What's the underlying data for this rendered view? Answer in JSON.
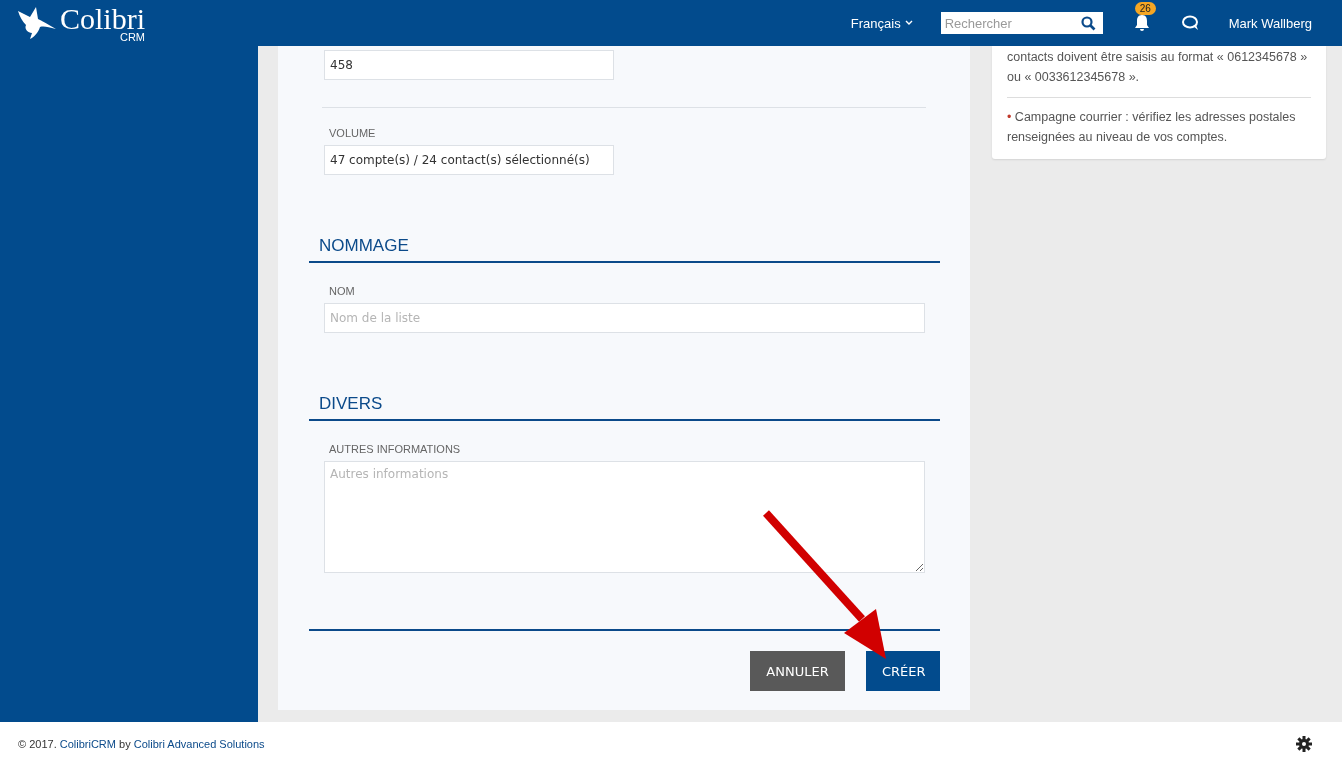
{
  "header": {
    "logo_title": "Colibri",
    "logo_subtitle": "CRM",
    "language": "Français",
    "search": {
      "placeholder": "Rechercher"
    },
    "notification_count": "26",
    "user": "Mark Wallberg"
  },
  "form": {
    "top_field": {
      "value": "458"
    },
    "volume": {
      "label": "VOLUME",
      "value": "47 compte(s) / 24 contact(s) sélectionné(s)"
    },
    "sections": [
      {
        "title": "NOMMAGE",
        "fields": [
          {
            "kind": "input",
            "label": "NOM",
            "placeholder": "Nom de la liste"
          }
        ]
      },
      {
        "title": "DIVERS",
        "fields": [
          {
            "kind": "textarea",
            "label": "AUTRES INFORMATIONS",
            "placeholder": "Autres informations"
          }
        ]
      }
    ],
    "buttons": [
      {
        "kind": "secondary",
        "label": "ANNULER"
      },
      {
        "kind": "primary",
        "label": "CRÉER"
      }
    ]
  },
  "side_panel": {
    "notes": [
      {
        "text": "contacts doivent être saisis au format « 0612345678 » ou « 0033612345678 »."
      },
      {
        "bullet": "•",
        "text": "Campagne courrier : vérifiez les adresses postales renseignées au niveau de vos comptes."
      }
    ]
  },
  "footer": {
    "prefix": "© 2017.",
    "link_1": "ColibriCRM",
    "middle": "by",
    "link_2": "Colibri Advanced Solutions"
  }
}
